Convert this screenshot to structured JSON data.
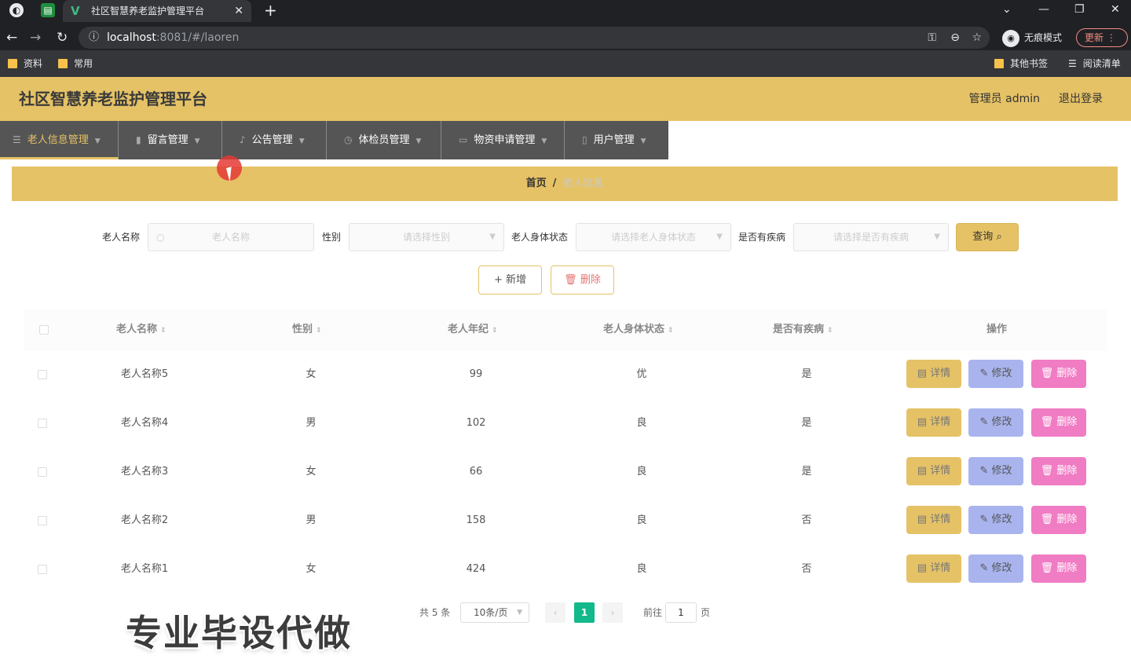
{
  "browser": {
    "tab_title": "社区智慧养老监护管理平台",
    "tab_close": "✕",
    "new_tab": "+",
    "url_host": "localhost",
    "url_rest": ":8081/#/laoren",
    "incognito_label": "无痕模式",
    "update_label": "更新",
    "bookmarks": [
      "资料",
      "常用"
    ],
    "other_bookmarks": "其他书签",
    "reading_list": "阅读清单"
  },
  "header": {
    "title": "社区智慧养老监护管理平台",
    "user": "管理员 admin",
    "logout": "退出登录"
  },
  "menu": [
    {
      "label": "老人信息管理",
      "icon": "menu-icon"
    },
    {
      "label": "留言管理",
      "icon": "chart-icon"
    },
    {
      "label": "公告管理",
      "icon": "bell-icon"
    },
    {
      "label": "体检员管理",
      "icon": "clock-icon"
    },
    {
      "label": "物资申请管理",
      "icon": "card-icon"
    },
    {
      "label": "用户管理",
      "icon": "phone-icon"
    }
  ],
  "breadcrumb": {
    "home": "首页",
    "sep": "/",
    "current": "老人信息"
  },
  "search": {
    "name_label": "老人名称",
    "name_placeholder": "老人名称",
    "gender_label": "性别",
    "gender_placeholder": "请选择性别",
    "status_label": "老人身体状态",
    "status_placeholder": "请选择老人身体状态",
    "disease_label": "是否有疾病",
    "disease_placeholder": "请选择是否有疾病",
    "query_label": "查询"
  },
  "actions": {
    "add": "+ 新增",
    "delete": "删除"
  },
  "table": {
    "headers": [
      "老人名称",
      "性别",
      "老人年纪",
      "老人身体状态",
      "是否有疾病",
      "操作"
    ],
    "rows": [
      {
        "name": "老人名称5",
        "gender": "女",
        "age": "99",
        "status": "优",
        "disease": "是"
      },
      {
        "name": "老人名称4",
        "gender": "男",
        "age": "102",
        "status": "良",
        "disease": "是"
      },
      {
        "name": "老人名称3",
        "gender": "女",
        "age": "66",
        "status": "良",
        "disease": "是"
      },
      {
        "name": "老人名称2",
        "gender": "男",
        "age": "158",
        "status": "良",
        "disease": "否"
      },
      {
        "name": "老人名称1",
        "gender": "女",
        "age": "424",
        "status": "良",
        "disease": "否"
      }
    ],
    "op_detail": "详情",
    "op_edit": "修改",
    "op_delete": "删除"
  },
  "pager": {
    "total": "共 5 条",
    "page_size": "10条/页",
    "current": "1",
    "goto_label": "前往",
    "goto_value": "1",
    "page_suffix": "页"
  },
  "watermark": "专业毕设代做",
  "colors": {
    "accent": "#e5c266",
    "menu_bg": "#555555",
    "pager_active": "#13b98a",
    "delete_btn": "#f07cc4",
    "edit_btn": "#a9b4ee"
  }
}
